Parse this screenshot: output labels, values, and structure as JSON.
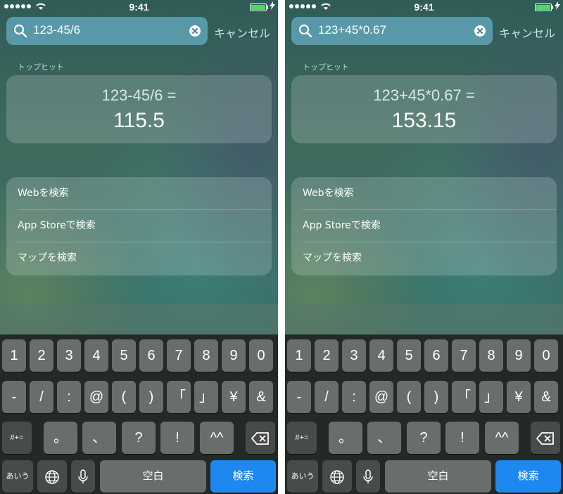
{
  "screens": [
    {
      "status": {
        "time": "9:41"
      },
      "search": {
        "query": "123-45/6",
        "cancel": "キャンセル"
      },
      "top_hit_label": "トップヒット",
      "calc": {
        "expression": "123-45/6 =",
        "result": "115.5"
      },
      "actions": [
        "Webを検索",
        "App Storeで検索",
        "マップを検索"
      ]
    },
    {
      "status": {
        "time": "9:41"
      },
      "search": {
        "query": "123+45*0.67",
        "cancel": "キャンセル"
      },
      "top_hit_label": "トップヒット",
      "calc": {
        "expression": "123+45*0.67 =",
        "result": "153.15"
      },
      "actions": [
        "Webを検索",
        "App Storeで検索",
        "マップを検索"
      ]
    }
  ],
  "keyboard": {
    "row1": [
      "1",
      "2",
      "3",
      "4",
      "5",
      "6",
      "7",
      "8",
      "9",
      "0"
    ],
    "row2": [
      "-",
      "/",
      ":",
      "@",
      "(",
      ")",
      "「",
      "」",
      "¥",
      "&"
    ],
    "row3": {
      "mode": "#+=",
      "keys": [
        "。",
        "、",
        "?",
        "!",
        "^^"
      ]
    },
    "row4": {
      "lang": "あいう",
      "space": "空白",
      "go": "検索"
    },
    "icons": [
      "globe-icon",
      "microphone-icon",
      "delete-icon"
    ]
  }
}
